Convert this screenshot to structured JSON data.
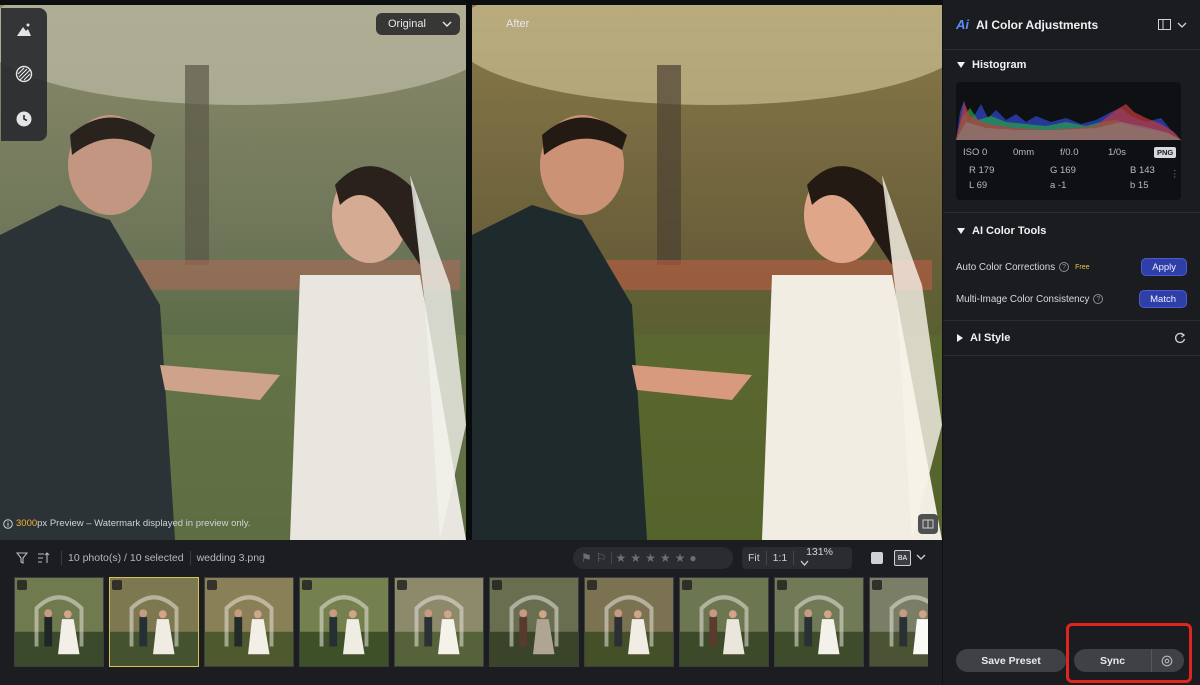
{
  "viewer": {
    "before_label": "Original",
    "after_label": "After",
    "preview_size": "3000",
    "preview_note": "px Preview – Watermark displayed in preview only."
  },
  "tool_rail": {
    "items": [
      {
        "icon": "ai-tone-icon"
      },
      {
        "icon": "pattern-icon"
      },
      {
        "icon": "history-icon"
      }
    ]
  },
  "filmstrip": {
    "count_text": "10 photo(s) / 10 selected",
    "filename": "wedding 3.png",
    "zoom": {
      "fit": "Fit",
      "one_to_one": "1:1",
      "percent": "131%"
    },
    "view_ba": "BA",
    "thumbnail_count": 10,
    "selected_index": 1
  },
  "panel": {
    "title": "AI Color Adjustments",
    "histogram": {
      "label": "Histogram",
      "exif": {
        "iso": "ISO 0",
        "focal": "0mm",
        "aperture": "f/0.0",
        "shutter": "1/0s",
        "format": "PNG"
      },
      "pixel": {
        "r": "R 179",
        "g": "G 169",
        "b": "B 143",
        "l": "L 69",
        "a": "a -1",
        "b2": "b 15"
      }
    },
    "color_tools": {
      "label": "AI Color Tools",
      "auto": {
        "label": "Auto Color Corrections",
        "badge": "Free",
        "button": "Apply"
      },
      "multi": {
        "label": "Multi-Image Color Consistency",
        "button": "Match"
      }
    },
    "style": {
      "label": "AI Style"
    },
    "save_preset": "Save Preset",
    "sync": "Sync"
  },
  "colors": {
    "accent": "#2f3fa8",
    "highlight": "#e0241f",
    "selected_border": "#d9c25a",
    "preview_accent": "#f2b53a"
  }
}
